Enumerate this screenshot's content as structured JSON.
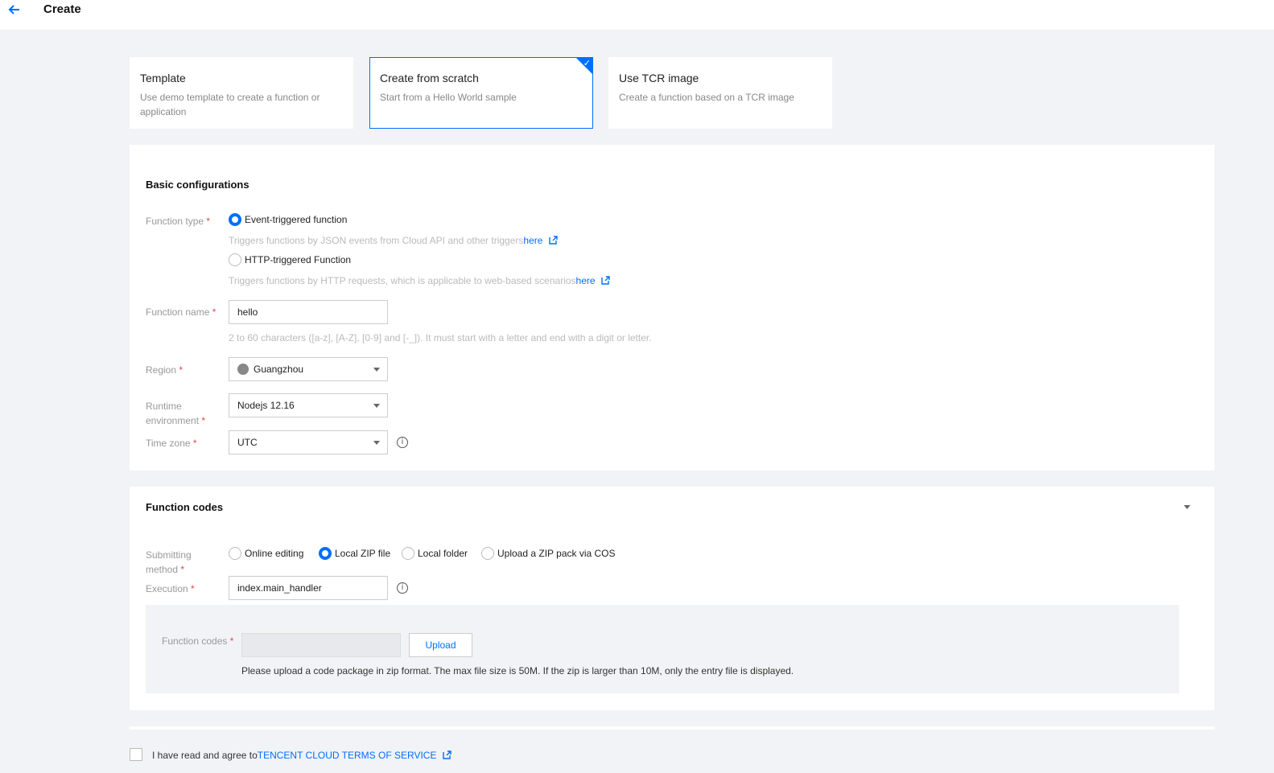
{
  "header": {
    "title": "Create"
  },
  "cards": [
    {
      "title": "Template",
      "desc": "Use demo template to create a function or application",
      "selected": false
    },
    {
      "title": "Create from scratch",
      "desc": "Start from a Hello World sample",
      "selected": true
    },
    {
      "title": "Use TCR image",
      "desc": "Create a function based on a TCR image",
      "selected": false
    }
  ],
  "basic": {
    "title": "Basic configurations",
    "function_type": {
      "label": "Function type",
      "options": [
        {
          "label": "Event-triggered function",
          "hint": "Triggers functions by JSON events from Cloud API and other triggers",
          "link": "here",
          "selected": true
        },
        {
          "label": "HTTP-triggered Function",
          "hint": "Triggers functions by HTTP requests, which is applicable to web-based scenarios",
          "link": "here",
          "selected": false
        }
      ]
    },
    "function_name": {
      "label": "Function name",
      "value": "hello",
      "hint": "2 to 60 characters ([a-z], [A-Z], [0-9] and [-_]). It must start with a letter and end with a digit or letter."
    },
    "region": {
      "label": "Region",
      "value": "Guangzhou"
    },
    "runtime": {
      "label": "Runtime environment",
      "value": "Nodejs 12.16"
    },
    "timezone": {
      "label": "Time zone",
      "value": "UTC"
    }
  },
  "codes": {
    "title": "Function codes",
    "submit_method": {
      "label": "Submitting method",
      "options": [
        {
          "label": "Online editing",
          "selected": false
        },
        {
          "label": "Local ZIP file",
          "selected": true
        },
        {
          "label": "Local folder",
          "selected": false
        },
        {
          "label": "Upload a ZIP pack via COS",
          "selected": false
        }
      ]
    },
    "execution": {
      "label": "Execution",
      "value": "index.main_handler"
    },
    "upload": {
      "label": "Function codes",
      "button": "Upload",
      "hint": "Please upload a code package in zip format. The max file size is 50M. If the zip is larger than 10M, only the entry file is displayed."
    }
  },
  "terms": {
    "prefix": "I have read and agree to",
    "link": "TENCENT CLOUD TERMS OF SERVICE"
  },
  "colors": {
    "accent": "#006eff",
    "required": "#e54545"
  }
}
